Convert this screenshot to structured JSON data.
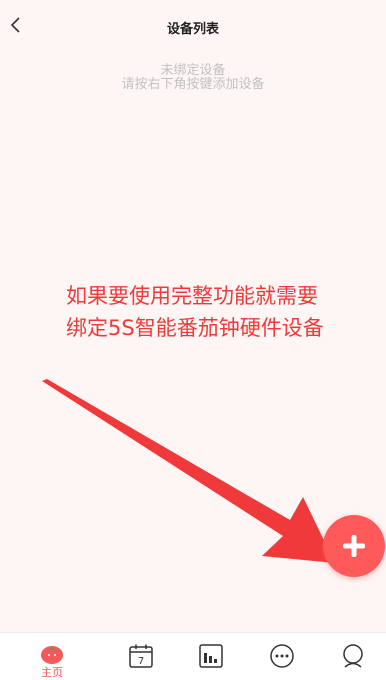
{
  "header": {
    "title": "设备列表",
    "back_icon": "chevron-left-icon"
  },
  "empty_state": {
    "line1": "未绑定设备",
    "line2": "请按右下角按键添加设备"
  },
  "annotation": {
    "line1": "如果要使用完整功能就需要",
    "line2": "绑定5S智能番茄钟硬件设备",
    "color": "#f0393a"
  },
  "fab": {
    "icon": "plus-icon",
    "color": "#ff5a5a"
  },
  "tabbar": {
    "home": {
      "label": "主页",
      "icon": "tomato-icon",
      "color": "#f55a5a"
    },
    "calendar": {
      "icon": "calendar-icon",
      "day": "7"
    },
    "stats": {
      "icon": "bar-chart-icon"
    },
    "chat": {
      "icon": "chat-bubble-icon"
    },
    "profile": {
      "icon": "user-icon"
    }
  }
}
